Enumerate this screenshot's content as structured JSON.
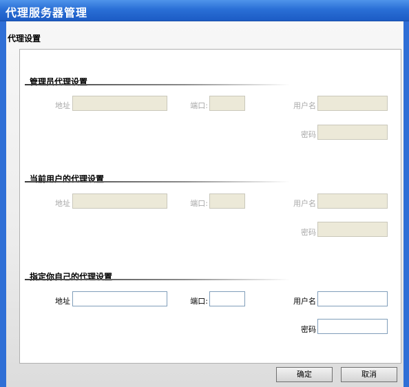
{
  "window": {
    "title": "代理服务器管理",
    "section_title": "代理设置"
  },
  "groups": [
    {
      "title": "管理员代理设置",
      "disabled": true,
      "address_label": "地址",
      "port_label": "端口:",
      "username_label": "用户名",
      "password_label": "密码",
      "address_value": "",
      "port_value": "",
      "username_value": "",
      "password_value": ""
    },
    {
      "title": "当前用户的代理设置",
      "disabled": true,
      "address_label": "地址",
      "port_label": "端口:",
      "username_label": "用户名",
      "password_label": "密码",
      "address_value": "",
      "port_value": "",
      "username_value": "",
      "password_value": ""
    },
    {
      "title": "指定你自己的代理设置",
      "disabled": false,
      "address_label": "地址",
      "port_label": "端口:",
      "username_label": "用户名",
      "password_label": "密码",
      "address_value": "",
      "port_value": "",
      "username_value": "",
      "password_value": ""
    }
  ],
  "buttons": {
    "ok_label": "确定",
    "cancel_label": "取消"
  },
  "colors": {
    "titlebar": "#2a6fd6",
    "disabled_field": "#ece9d8",
    "disabled_text": "#a8a8a8"
  }
}
